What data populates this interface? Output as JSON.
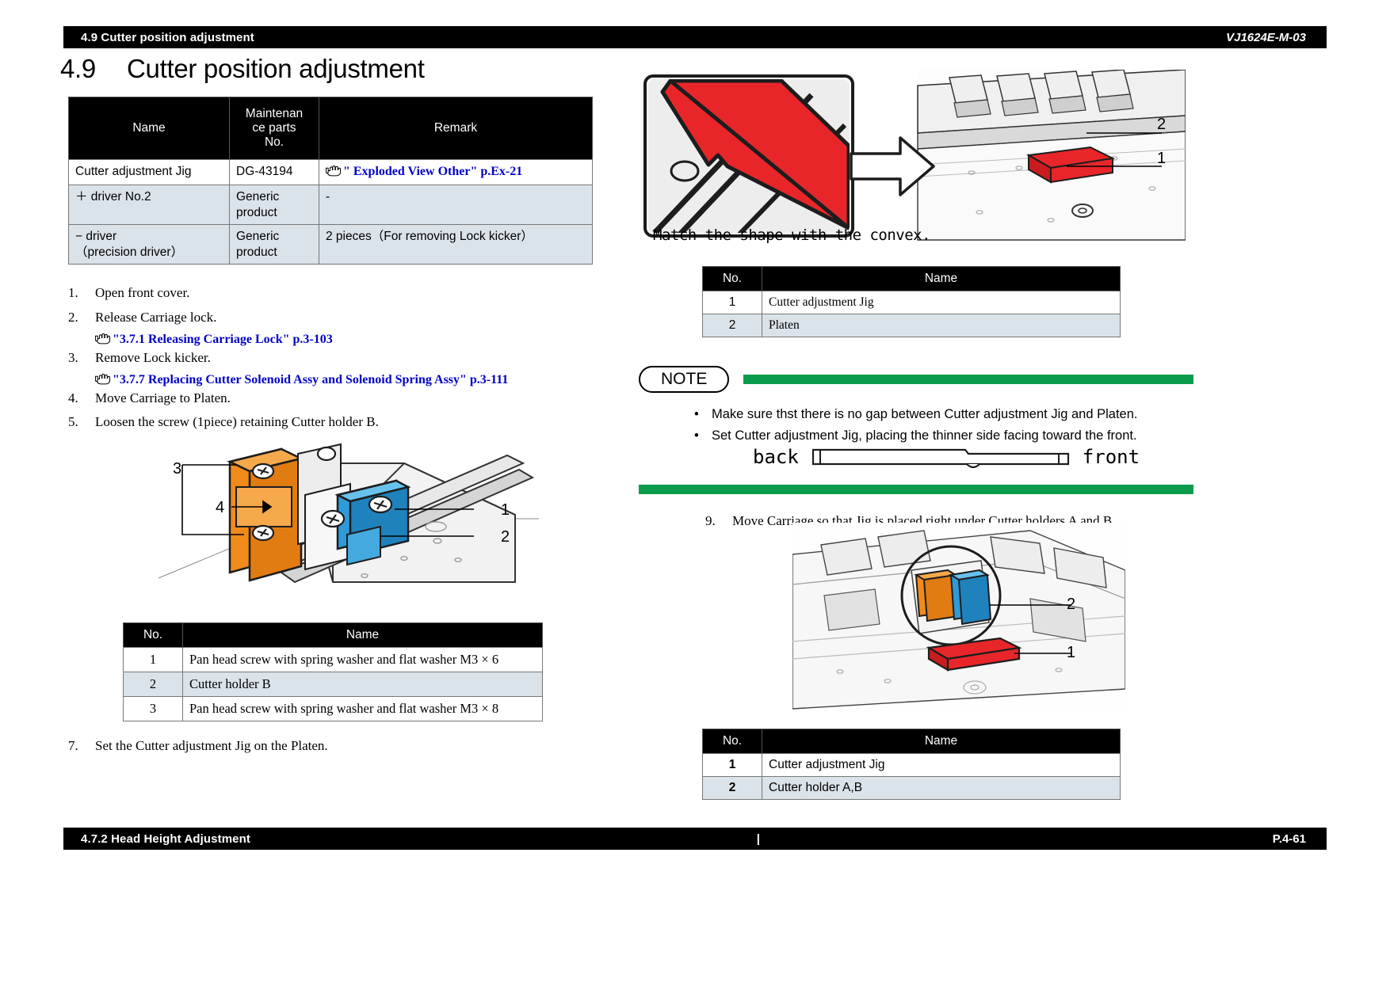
{
  "header": {
    "section": "4.9 Cutter position adjustment",
    "model": "VJ1624E-M-03"
  },
  "footer": {
    "section": "4.7.2 Head Height Adjustment",
    "separator": "|",
    "page": "P.4-61"
  },
  "title": {
    "number": "4.9",
    "text": "Cutter position adjustment"
  },
  "parts_table": {
    "headers": [
      "Name",
      "Maintenance parts No.",
      "Remark"
    ],
    "header_name": "Name",
    "header_parts_no": "Maintenan\nce parts\nNo.",
    "header_remark": "Remark",
    "rows": [
      {
        "name": "Cutter adjustment Jig",
        "parts_no": "DG-43194",
        "remark_link": "\" Exploded View    Other\" p.Ex-21",
        "remark_plain": ""
      },
      {
        "name": "＋ driver No.2",
        "parts_no": "Generic product",
        "remark_link": "",
        "remark_plain": "-"
      },
      {
        "name": "− driver\n（precision driver）",
        "parts_no": "Generic product",
        "remark_link": "",
        "remark_plain": "2 pieces（For removing Lock kicker）"
      }
    ]
  },
  "steps": [
    {
      "number": "1.",
      "text": "Open front cover.",
      "ref": ""
    },
    {
      "number": "2.",
      "text": "Release Carriage lock.",
      "ref": "\"3.7.1 Releasing Carriage Lock\" p.3-103"
    },
    {
      "number": "3.",
      "text": "Remove Lock kicker.",
      "ref": "\"3.7.7 Replacing Cutter Solenoid Assy and Solenoid Spring Assy\" p.3-111"
    },
    {
      "number": "4.",
      "text": "Move Carriage to Platen.",
      "ref": ""
    },
    {
      "number": "5.",
      "text": "Loosen the screw (1piece) retaining Cutter holder B.",
      "ref": ""
    },
    {
      "number": "7.",
      "text": "Set the Cutter adjustment Jig on the Platen.",
      "ref": ""
    },
    {
      "number": "9.",
      "text": "Move Carriage so that Jig is placed right under Cutter holders A and B.",
      "ref": ""
    }
  ],
  "figure_cutter_holder": {
    "callouts": [
      "3",
      "4",
      "1",
      "2"
    ],
    "table": {
      "headers": [
        "No.",
        "Name"
      ],
      "rows": [
        {
          "no": "1",
          "name": "Pan head screw with spring washer and flat washer M3 × 6"
        },
        {
          "no": "2",
          "name": "Cutter holder B"
        },
        {
          "no": "3",
          "name": "Pan head screw with spring washer and flat washer M3 × 8"
        }
      ]
    }
  },
  "figure_jig_platen": {
    "caption": "Match the shape with the convex.",
    "callouts": [
      "2",
      "1"
    ],
    "table": {
      "headers": [
        "No.",
        "Name"
      ],
      "rows": [
        {
          "no": "1",
          "name": "Cutter adjustment Jig"
        },
        {
          "no": "2",
          "name": "Platen"
        }
      ]
    }
  },
  "figure_carriage_jig": {
    "callouts": [
      "2",
      "1"
    ],
    "table": {
      "headers": [
        "No.",
        "Name"
      ],
      "rows": [
        {
          "no": "1",
          "name": "Cutter adjustment Jig"
        },
        {
          "no": "2",
          "name": "Cutter holder A,B"
        }
      ]
    }
  },
  "note": {
    "label": "NOTE",
    "items": [
      "Make sure thst there is no gap between Cutter adjustment Jig and Platen.",
      "Set Cutter adjustment Jig, placing the thinner side facing toward the front."
    ],
    "back_label": "back",
    "front_label": "front"
  },
  "colors": {
    "accent_red": "#e8262a",
    "note_green": "#0a9c4c",
    "link_blue": "#0000c8",
    "table_alt": "#dbe3ea",
    "bar_black": "#000000"
  }
}
